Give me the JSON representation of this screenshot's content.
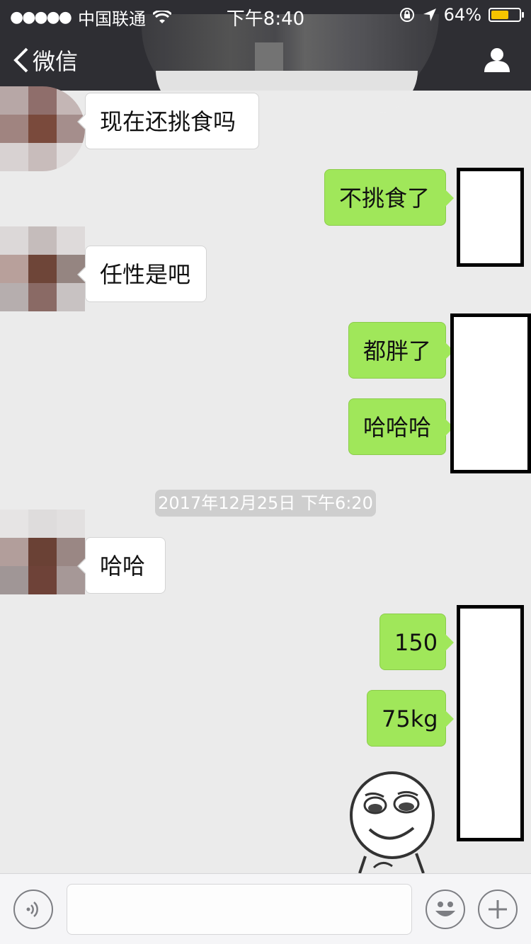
{
  "status_bar": {
    "signal": "●●●●●",
    "carrier": "中国联通",
    "time": "下午8:40",
    "battery_text": "64%",
    "battery_level": 0.64
  },
  "nav": {
    "back_label": "微信"
  },
  "messages": [
    {
      "side": "in",
      "text": "现在还挑食吗"
    },
    {
      "side": "out",
      "text": "不挑食了"
    },
    {
      "side": "in",
      "text": "任性是吧"
    },
    {
      "side": "out",
      "text": "都胖了"
    },
    {
      "side": "out",
      "text": "哈哈哈"
    },
    {
      "side": "in",
      "text": "哈哈"
    },
    {
      "side": "out",
      "text": "150"
    },
    {
      "side": "out",
      "text": "75kg"
    }
  ],
  "timestamp": "2017年12月25日 下午6:20",
  "colors": {
    "nav_bg": "#2e2e33",
    "chat_bg": "#ebebeb",
    "outgoing_bubble": "#a0e75a",
    "incoming_bubble": "#ffffff",
    "battery": "#f5c400"
  },
  "icons": {
    "back": "chevron-left-icon",
    "profile": "person-icon",
    "voice": "voice-icon",
    "emoji": "smiley-icon",
    "more": "plus-icon"
  }
}
